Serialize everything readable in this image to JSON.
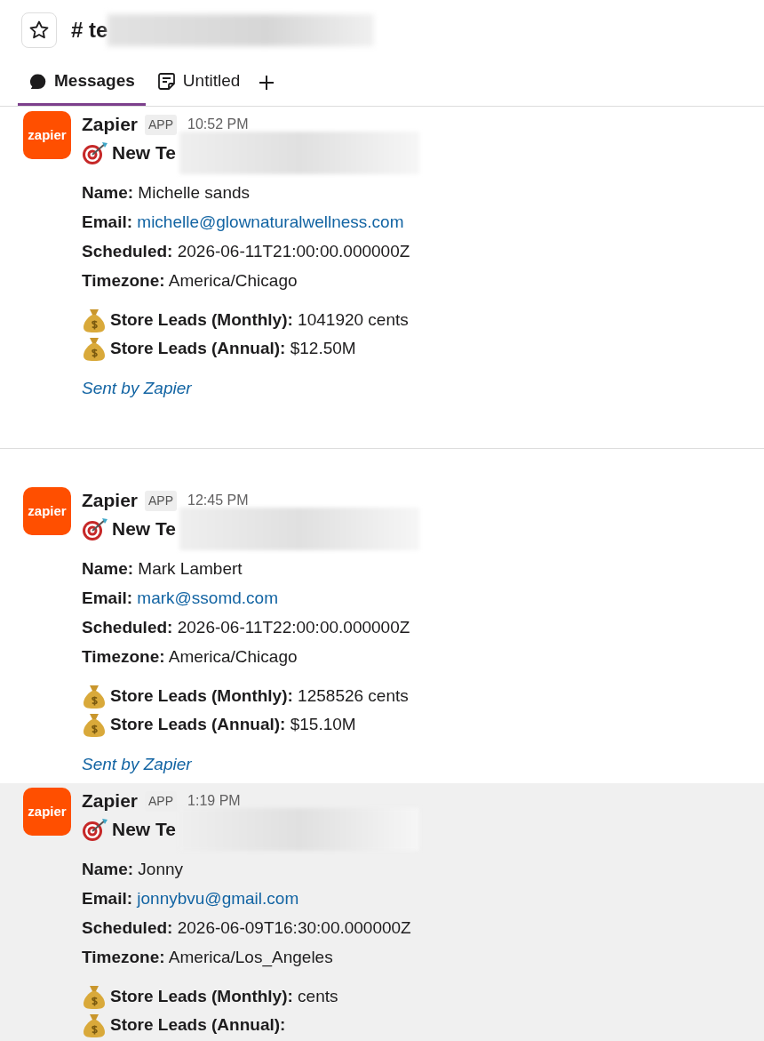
{
  "header": {
    "channel_name": "# te"
  },
  "tabs": [
    {
      "label": "Messages",
      "selected": true
    },
    {
      "label": "Untitled",
      "selected": false
    }
  ],
  "messages": [
    {
      "avatar_text": "zapier",
      "sender": "Zapier",
      "badge": "APP",
      "time": "10:52 PM",
      "title": "New Te",
      "highlighted": false,
      "fields": [
        {
          "label": "Name:",
          "value": "Michelle sands",
          "kind": "text"
        },
        {
          "label": "Email:",
          "value": "michelle@glownaturalwellness.com",
          "kind": "link"
        },
        {
          "label": "Scheduled:",
          "value": "2026-06-11T21:00:00.000000Z",
          "kind": "text"
        },
        {
          "label": "Timezone:",
          "value": "America/Chicago",
          "kind": "text"
        }
      ],
      "leads": [
        {
          "label": "Store Leads (Monthly):",
          "value": "1041920 cents"
        },
        {
          "label": "Store Leads (Annual):",
          "value": "$12.50M"
        }
      ],
      "footer": "Sent by Zapier"
    },
    {
      "kind": "divider"
    },
    {
      "avatar_text": "zapier",
      "sender": "Zapier",
      "badge": "APP",
      "time": "12:45 PM",
      "title": "New Te",
      "highlighted": false,
      "fields": [
        {
          "label": "Name:",
          "value": "Mark Lambert",
          "kind": "text"
        },
        {
          "label": "Email:",
          "value": "mark@ssomd.com",
          "kind": "link"
        },
        {
          "label": "Scheduled:",
          "value": "2026-06-11T22:00:00.000000Z",
          "kind": "text"
        },
        {
          "label": "Timezone:",
          "value": "America/Chicago",
          "kind": "text"
        }
      ],
      "leads": [
        {
          "label": "Store Leads (Monthly):",
          "value": "1258526 cents"
        },
        {
          "label": "Store Leads (Annual):",
          "value": "$15.10M"
        }
      ],
      "footer": "Sent by Zapier"
    },
    {
      "avatar_text": "zapier",
      "sender": "Zapier",
      "badge": "APP",
      "time": "1:19 PM",
      "title": "New Te",
      "highlighted": true,
      "fields": [
        {
          "label": "Name:",
          "value": "Jonny",
          "kind": "text"
        },
        {
          "label": "Email:",
          "value": "jonnybvu@gmail.com",
          "kind": "link"
        },
        {
          "label": "Scheduled:",
          "value": "2026-06-09T16:30:00.000000Z",
          "kind": "text"
        },
        {
          "label": "Timezone:",
          "value": "America/Los_Angeles",
          "kind": "text"
        }
      ],
      "leads": [
        {
          "label": "Store Leads (Monthly):",
          "value": "cents"
        },
        {
          "label": "Store Leads (Annual):"
        }
      ]
    }
  ]
}
